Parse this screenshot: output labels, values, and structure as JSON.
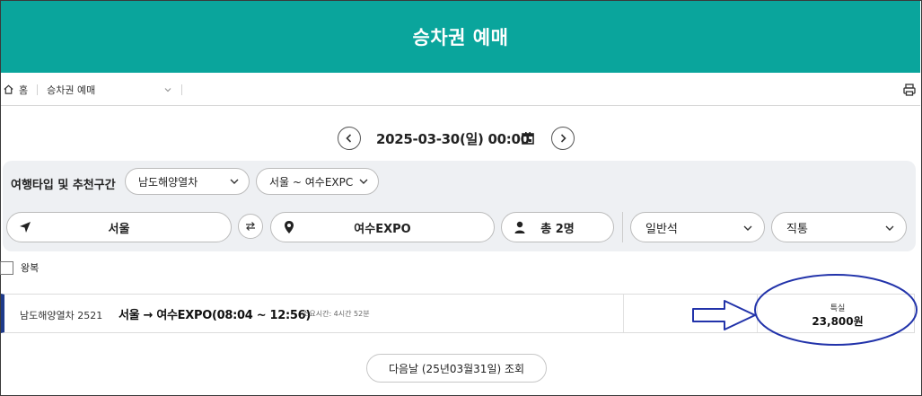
{
  "header": {
    "title": "승차권 예매"
  },
  "breadcrumb": {
    "home": "홈",
    "current": "승차권 예매"
  },
  "date": {
    "value": "2025-03-30(일) 00:00"
  },
  "search": {
    "type_label": "여행타입 및 추천구간",
    "travel_type": "남도해양열차",
    "route": "서울 ~ 여수EXPC",
    "departure": "서울",
    "arrival": "여수EXPO",
    "passengers": "총 2명",
    "seat_class": "일반석",
    "transfer": "직통"
  },
  "roundtrip": {
    "label": "왕복"
  },
  "results": [
    {
      "train": "남도해양열차 2521",
      "route": "서울 → 여수EXPO(08:04 ~ 12:56)",
      "duration": "소요시간: 4시간 52분",
      "seat_type": "특실",
      "price": "23,800원"
    }
  ],
  "next_day": {
    "label": "다음날 (25년03월31일) 조회"
  },
  "colors": {
    "brand": "#0aa59c",
    "annotation": "#2233aa",
    "card_accent": "#1e3a8a"
  },
  "icons": [
    "home-icon",
    "chevron-down-icon",
    "print-icon",
    "chevron-left-icon",
    "chevron-right-icon",
    "calendar-icon",
    "location-arrow-icon",
    "swap-icon",
    "map-pin-icon",
    "person-icon"
  ]
}
